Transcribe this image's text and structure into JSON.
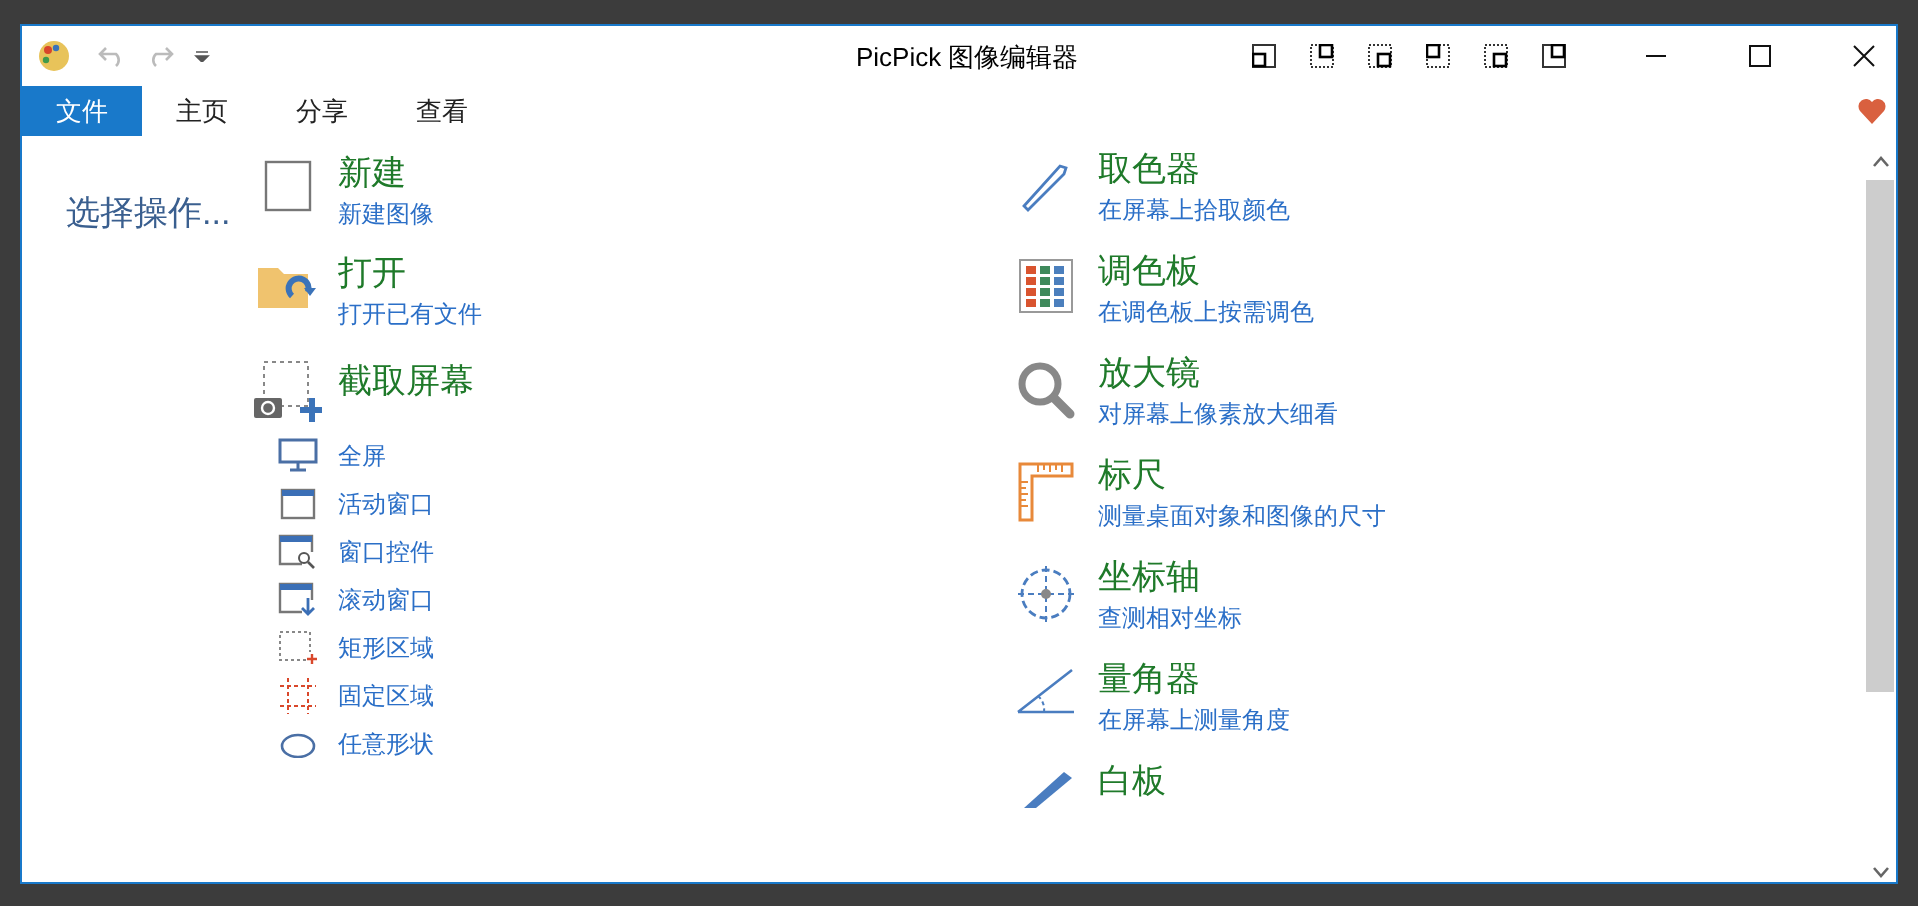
{
  "window": {
    "title": "PicPick 图像编辑器"
  },
  "tabs": [
    {
      "label": "文件",
      "selected": true
    },
    {
      "label": "主页",
      "selected": false
    },
    {
      "label": "分享",
      "selected": false
    },
    {
      "label": "查看",
      "selected": false
    }
  ],
  "sidebar": {
    "heading": "选择操作..."
  },
  "file_actions": [
    {
      "title": "新建",
      "subtitle": "新建图像"
    },
    {
      "title": "打开",
      "subtitle": "打开已有文件"
    }
  ],
  "capture": {
    "title": "截取屏幕",
    "modes": [
      {
        "label": "全屏"
      },
      {
        "label": "活动窗口"
      },
      {
        "label": "窗口控件"
      },
      {
        "label": "滚动窗口"
      },
      {
        "label": "矩形区域"
      },
      {
        "label": "固定区域"
      },
      {
        "label": "任意形状"
      }
    ]
  },
  "tools": [
    {
      "title": "取色器",
      "subtitle": "在屏幕上拾取颜色"
    },
    {
      "title": "调色板",
      "subtitle": "在调色板上按需调色"
    },
    {
      "title": "放大镜",
      "subtitle": "对屏幕上像素放大细看"
    },
    {
      "title": "标尺",
      "subtitle": "测量桌面对象和图像的尺寸"
    },
    {
      "title": "坐标轴",
      "subtitle": "查测相对坐标"
    },
    {
      "title": "量角器",
      "subtitle": "在屏幕上测量角度"
    },
    {
      "title": "白板"
    }
  ]
}
